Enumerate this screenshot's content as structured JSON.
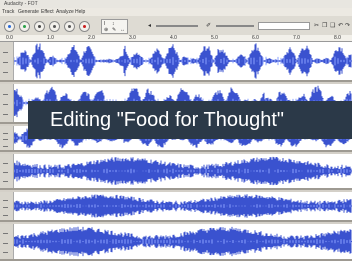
{
  "window": {
    "title": "Audacity - FOT"
  },
  "menu": [
    "Track",
    "Generate",
    "Effect",
    "Analyze",
    "Help"
  ],
  "toolbar": {
    "buttons": [
      {
        "name": "pause-button",
        "icon": "pause-icon"
      },
      {
        "name": "play-button",
        "icon": "play-icon"
      },
      {
        "name": "stop-button",
        "icon": "stop-icon"
      },
      {
        "name": "skip-start-button",
        "icon": "skip-start-icon"
      },
      {
        "name": "skip-end-button",
        "icon": "skip-end-icon"
      },
      {
        "name": "record-button",
        "icon": "record-icon",
        "color": "#c81e1e"
      }
    ]
  },
  "ruler": {
    "ticks": [
      "0.0",
      "1.0",
      "2.0",
      "3.0",
      "4.0",
      "5.0",
      "6.0",
      "7.0",
      "8.0"
    ]
  },
  "overlay": {
    "caption": "Editing \"Food for Thought\""
  },
  "colors": {
    "waveform": "#3a52cf",
    "waveform_peak": "#8aa0ff",
    "track_bg": "#ffffff",
    "banner_bg": "#2b3948"
  },
  "tracks": [
    {
      "name": "track-1",
      "channels": 2
    },
    {
      "name": "track-2",
      "channels": 2
    },
    {
      "name": "track-3",
      "channels": 1
    },
    {
      "name": "track-4",
      "channels": 1
    },
    {
      "name": "track-5",
      "channels": 1
    }
  ]
}
